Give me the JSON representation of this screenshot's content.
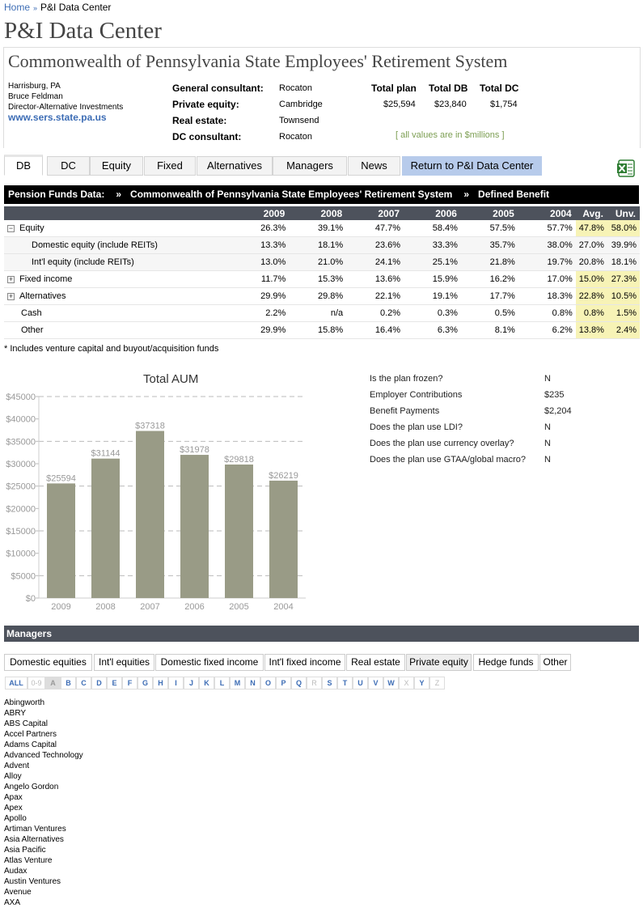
{
  "breadcrumb": {
    "home": "Home",
    "sep": "»",
    "current": "P&I Data Center"
  },
  "site_title": "P&I Data Center",
  "org": {
    "name": "Commonwealth of Pennsylvania State Employees' Retirement System",
    "city": "Harrisburg, PA",
    "contact": "Bruce Feldman",
    "role": "Director-Alternative Investments",
    "website": "www.sers.state.pa.us"
  },
  "consultants": {
    "general_label": "General consultant:",
    "general": "Rocaton",
    "pe_label": "Private equity:",
    "pe": "Cambridge",
    "re_label": "Real estate:",
    "re": "Townsend",
    "dc_label": "DC consultant:",
    "dc": "Rocaton"
  },
  "totals": {
    "plan_label": "Total plan",
    "plan": "$25,594",
    "db_label": "Total DB",
    "db": "$23,840",
    "dc_label": "Total DC",
    "dc": "$1,754",
    "note": "[ all values are in $millions ]"
  },
  "tabs": [
    "DB",
    "DC",
    "Equity",
    "Fixed",
    "Alternatives",
    "Managers",
    "News",
    "Return to P&I Data Center"
  ],
  "bar": {
    "a": "Pension Funds Data:",
    "sep": "»",
    "b": "Commonwealth of Pennsylvania State Employees' Retirement System",
    "c": "Defined Benefit"
  },
  "table": {
    "headers": [
      "2009",
      "2008",
      "2007",
      "2006",
      "2005",
      "2004",
      "Avg.",
      "Unv."
    ],
    "rows": [
      {
        "label": "Equity",
        "vals": [
          "26.3%",
          "39.1%",
          "47.7%",
          "58.4%",
          "57.5%",
          "57.7%",
          "47.8%",
          "58.0%"
        ]
      },
      {
        "label": "Domestic equity (include REITs)",
        "vals": [
          "13.3%",
          "18.1%",
          "23.6%",
          "33.3%",
          "35.7%",
          "38.0%",
          "27.0%",
          "39.9%"
        ]
      },
      {
        "label": "Int'l equity (include REITs)",
        "vals": [
          "13.0%",
          "21.0%",
          "24.1%",
          "25.1%",
          "21.8%",
          "19.7%",
          "20.8%",
          "18.1%"
        ]
      },
      {
        "label": "Fixed income",
        "vals": [
          "11.7%",
          "15.3%",
          "13.6%",
          "15.9%",
          "16.2%",
          "17.0%",
          "15.0%",
          "27.3%"
        ]
      },
      {
        "label": "Alternatives",
        "vals": [
          "29.9%",
          "29.8%",
          "22.1%",
          "19.1%",
          "17.7%",
          "18.3%",
          "22.8%",
          "10.5%"
        ]
      },
      {
        "label": "Cash",
        "vals": [
          "2.2%",
          "n/a",
          "0.2%",
          "0.3%",
          "0.5%",
          "0.8%",
          "0.8%",
          "1.5%"
        ]
      },
      {
        "label": "Other",
        "vals": [
          "29.9%",
          "15.8%",
          "16.4%",
          "6.3%",
          "8.1%",
          "6.2%",
          "13.8%",
          "2.4%"
        ]
      }
    ],
    "footnote": "* Includes venture capital and buyout/acquisition funds"
  },
  "chart_data": {
    "type": "bar",
    "title": "Total AUM",
    "categories": [
      "2009",
      "2008",
      "2007",
      "2006",
      "2005",
      "2004"
    ],
    "values": [
      25594,
      31144,
      37318,
      31978,
      29818,
      26219
    ],
    "value_labels": [
      "$25594",
      "$31144",
      "$37318",
      "$31978",
      "$29818",
      "$26219"
    ],
    "yticks": [
      "$0",
      "$5000",
      "$10000",
      "$15000",
      "$20000",
      "$25000",
      "$30000",
      "$35000",
      "$40000",
      "$45000"
    ],
    "ylim": [
      0,
      45000
    ],
    "color": "#999b86"
  },
  "questions": [
    {
      "q": "Is the plan frozen?",
      "a": "N"
    },
    {
      "q": "Employer Contributions",
      "a": "$235"
    },
    {
      "q": "Benefit Payments",
      "a": "$2,204"
    },
    {
      "q": "Does the plan use LDI?",
      "a": "N"
    },
    {
      "q": "Does the plan use currency overlay?",
      "a": "N"
    },
    {
      "q": "Does the plan use GTAA/global macro?",
      "a": "N"
    }
  ],
  "managers": {
    "title": "Managers",
    "categories": [
      "Domestic equities",
      "Int'l equities",
      "Domestic fixed income",
      "Int'l fixed income",
      "Real estate",
      "Private equity",
      "Hedge funds",
      "Other"
    ],
    "letters": [
      "ALL",
      "0-9",
      "A",
      "B",
      "C",
      "D",
      "E",
      "F",
      "G",
      "H",
      "I",
      "J",
      "K",
      "L",
      "M",
      "N",
      "O",
      "P",
      "Q",
      "R",
      "S",
      "T",
      "U",
      "V",
      "W",
      "X",
      "Y",
      "Z"
    ],
    "list": [
      "Abingworth",
      "ABRY",
      "ABS Capital",
      "Accel Partners",
      "Adams Capital",
      "Advanced Technology",
      "Advent",
      "Alloy",
      "Angelo Gordon",
      "Apax",
      "Apex",
      "Apollo",
      "Artiman Ventures",
      "Asia Alternatives",
      "Asia Pacific",
      "Atlas Venture",
      "Audax",
      "Austin Ventures",
      "Avenue",
      "AXA"
    ]
  }
}
